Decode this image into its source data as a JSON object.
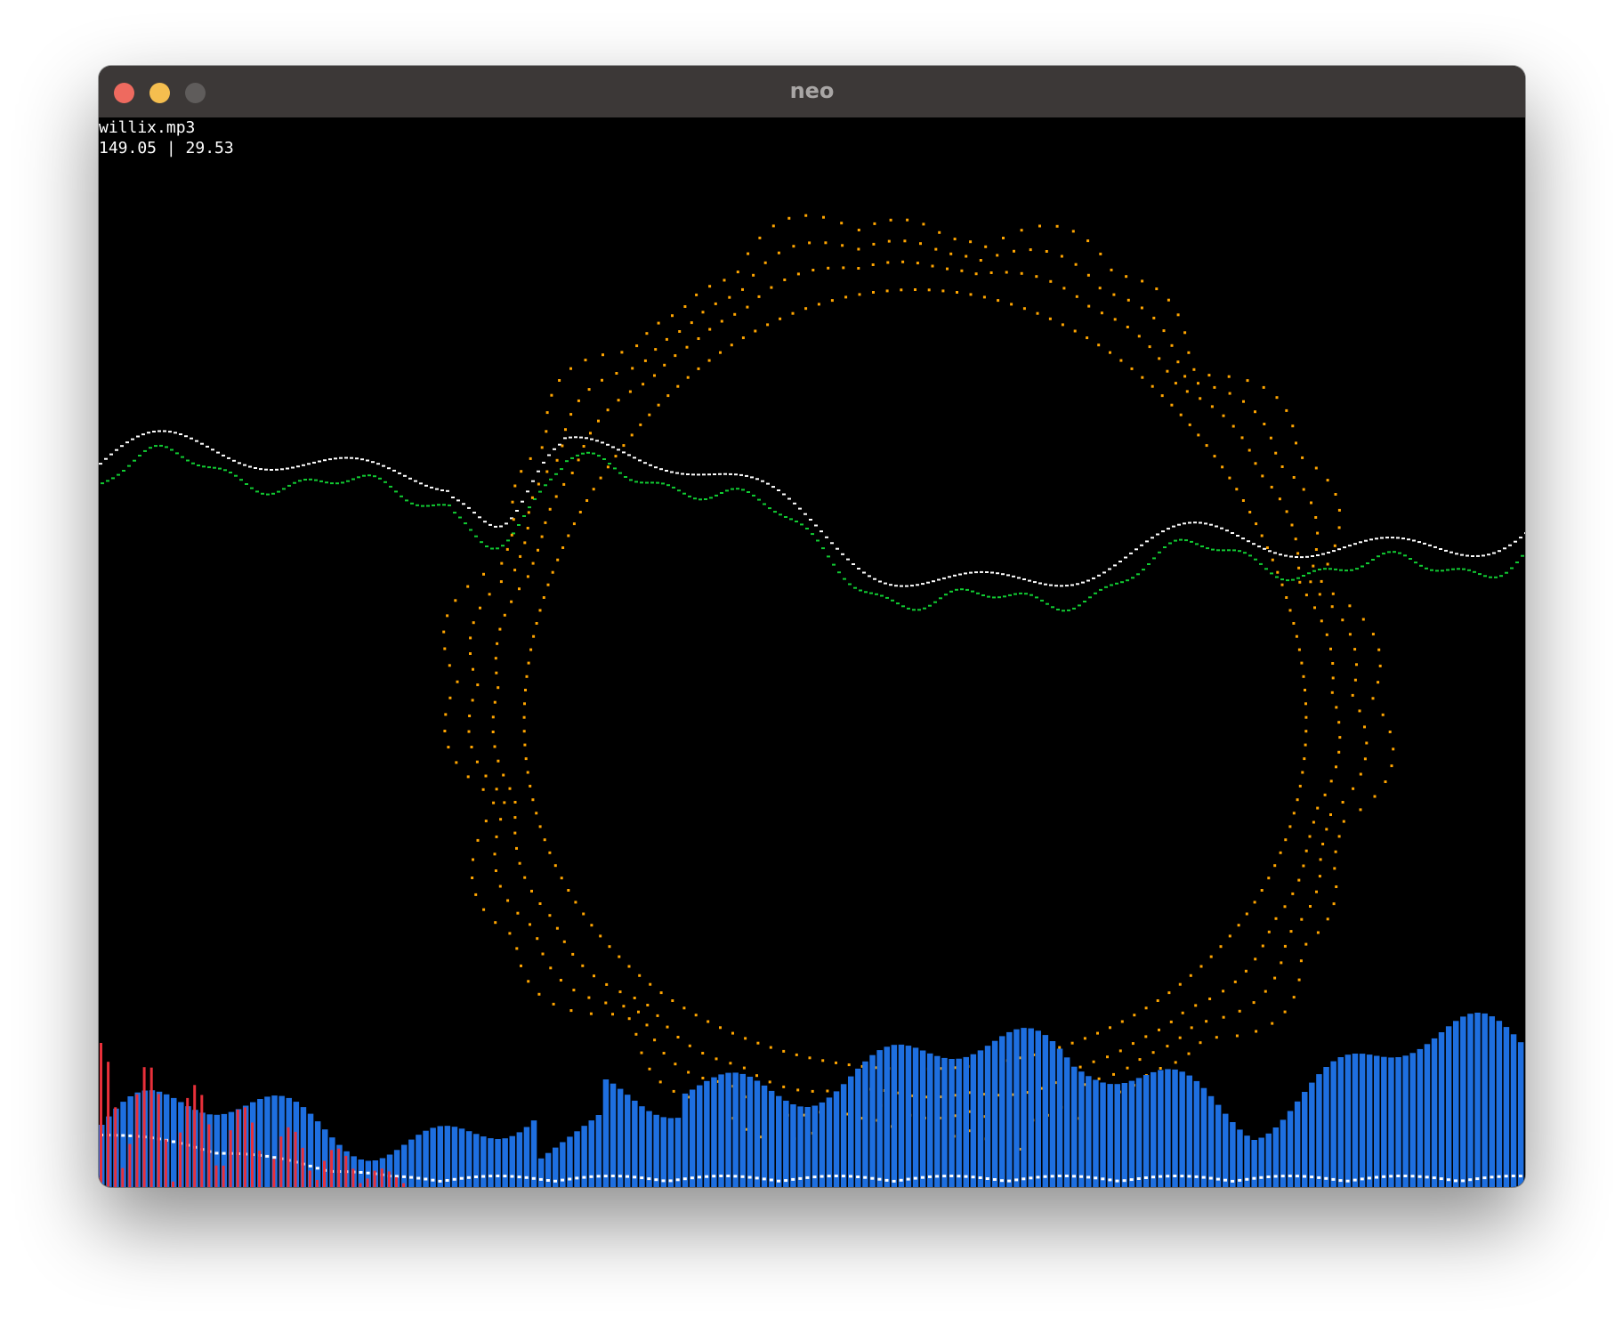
{
  "window": {
    "title": "neo",
    "controls": [
      "close",
      "minimize",
      "maximize"
    ]
  },
  "hud": {
    "filename": "willix.mp3",
    "timecode": "149.05 | 29.53"
  },
  "colors": {
    "ring": "#ffa500",
    "waveform_white": "#ffffff",
    "waveform_green": "#11cc33",
    "bars": "#1e6fe0",
    "peak_markers": "#ffffff",
    "low_bars": "#e8303a",
    "background": "#000000",
    "titlebar": "#3c3837"
  }
}
